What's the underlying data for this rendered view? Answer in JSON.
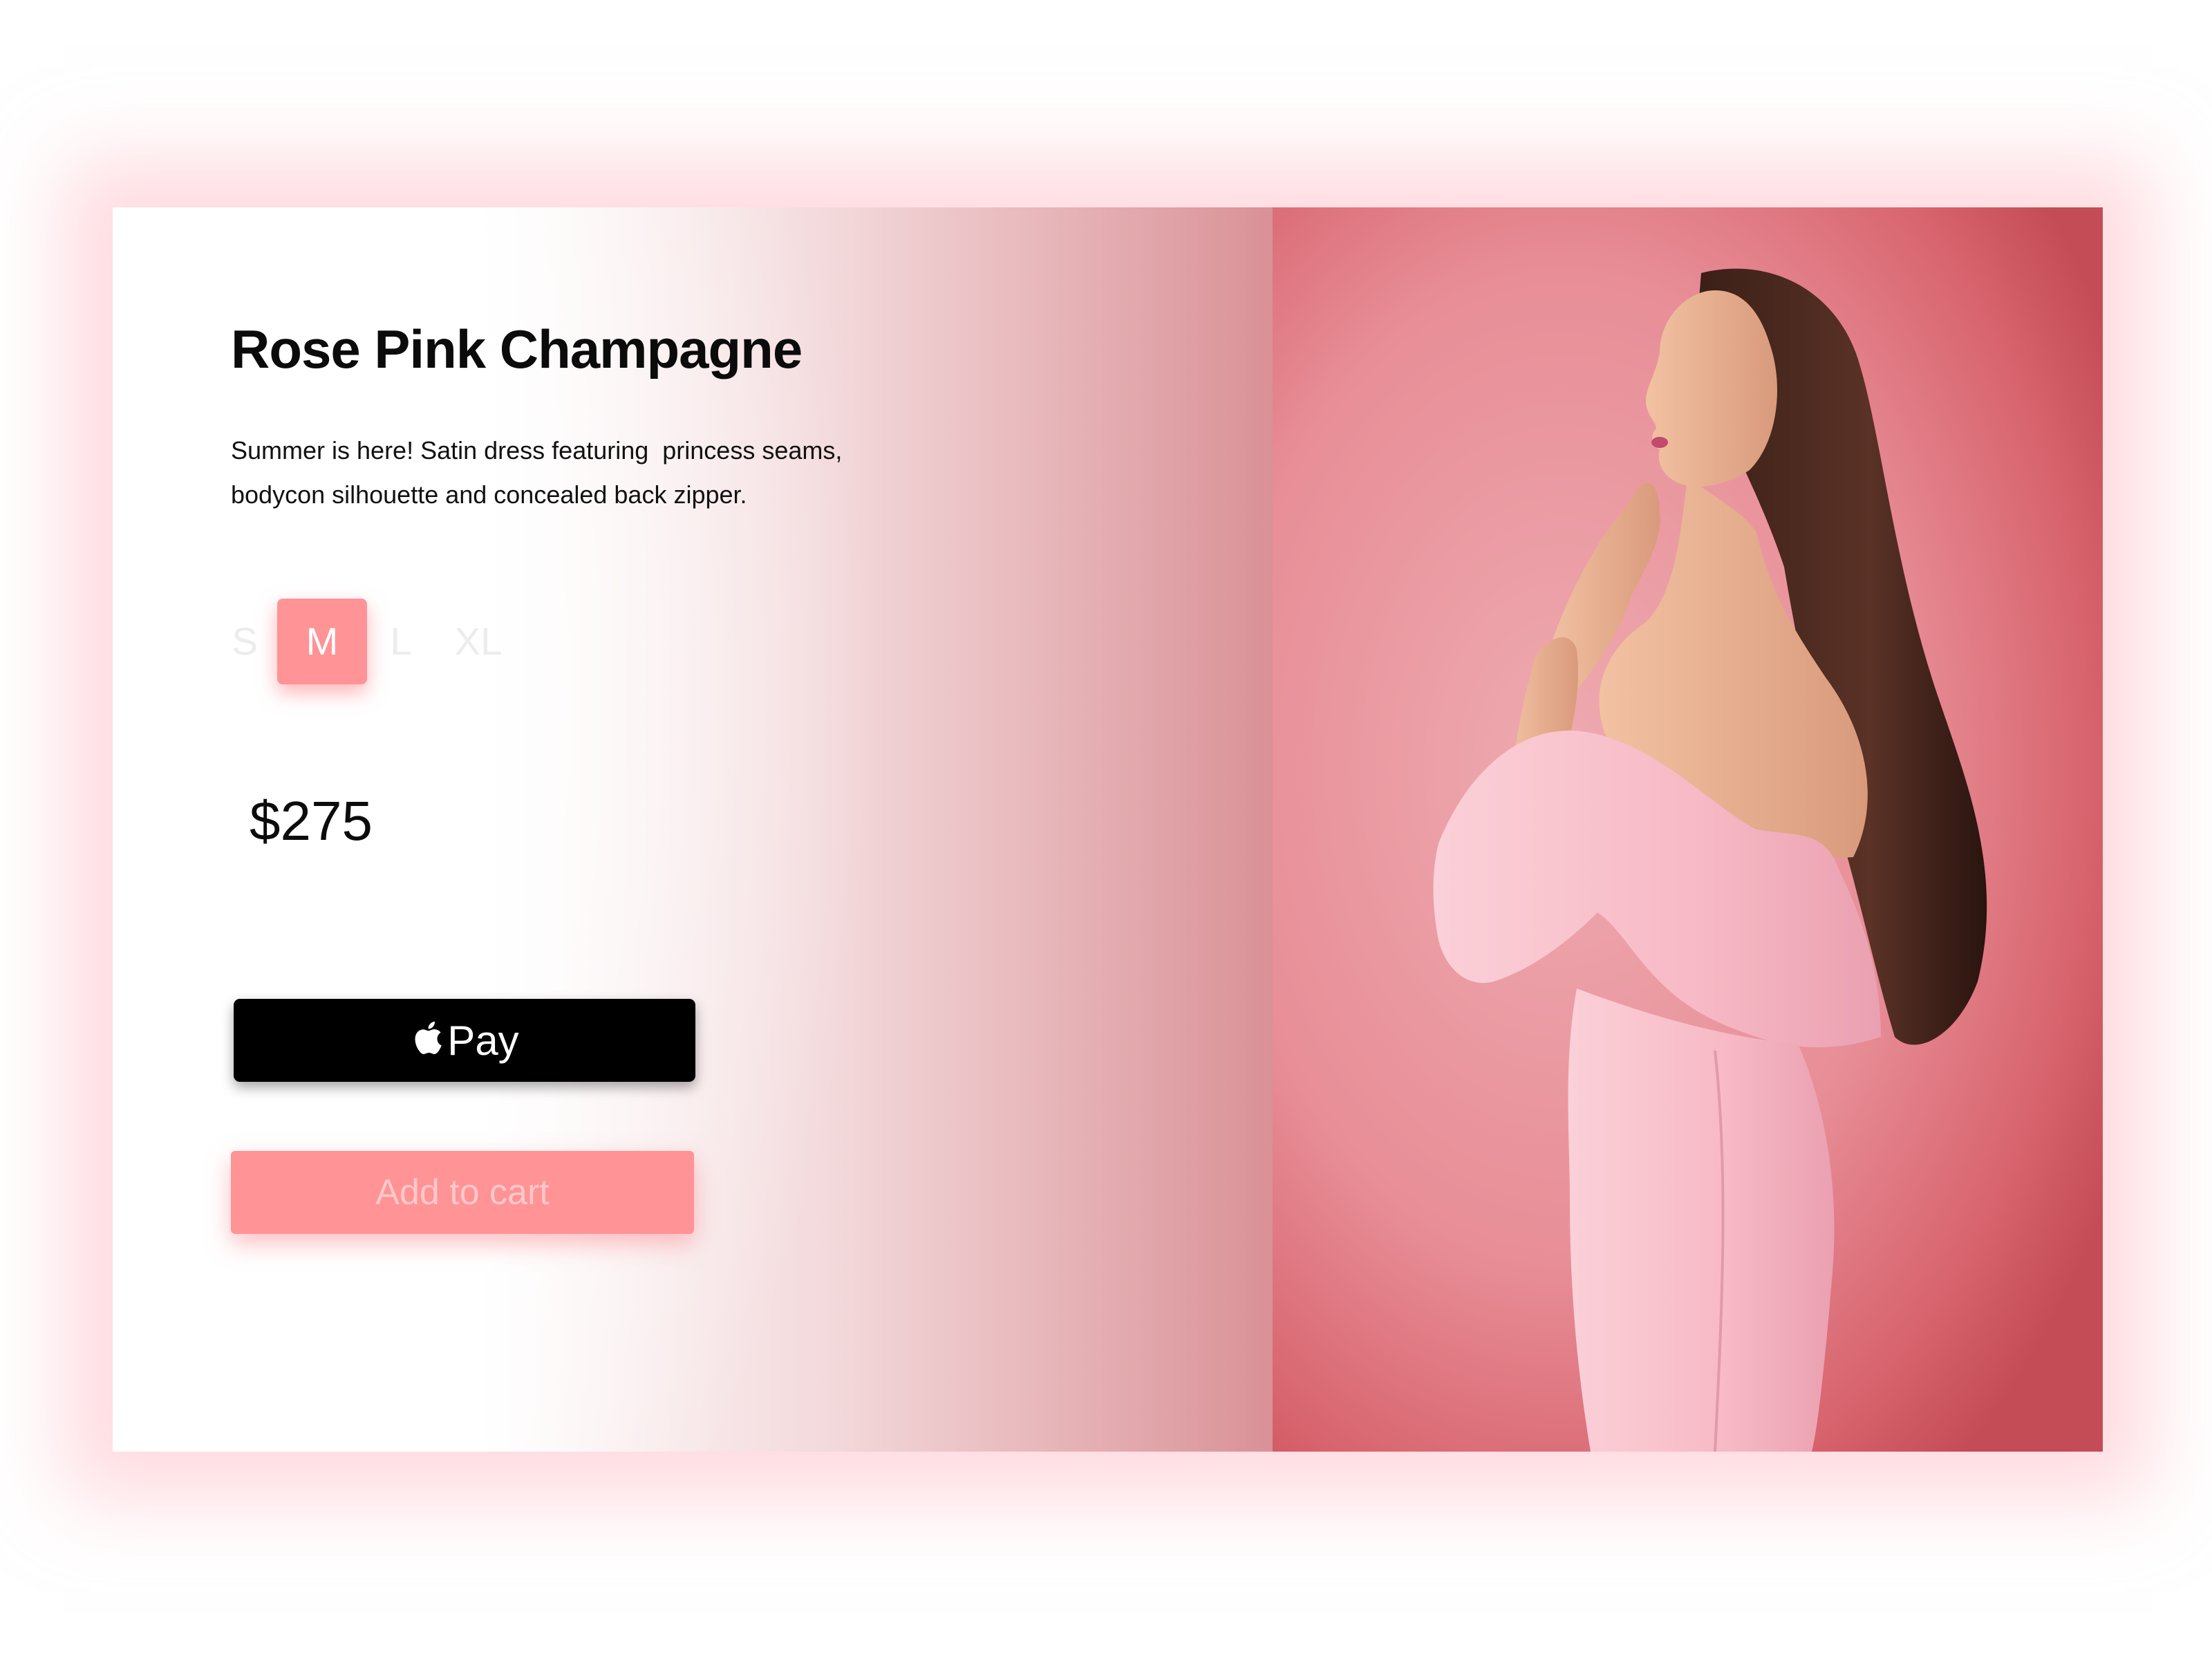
{
  "product": {
    "title": "Rose Pink Champagne",
    "description_lines": [
      "Summer is here! Satin dress featuring  princess seams,",
      "bodycon silhouette and concealed back zipper."
    ],
    "sizes": [
      "S",
      "M",
      "L",
      "XL"
    ],
    "selected_size": "M",
    "price": "$275"
  },
  "actions": {
    "apple_pay_label": "Pay",
    "add_to_cart_label": "Add to cart"
  },
  "colors": {
    "accent": "#ff9396",
    "apple_pay_bg": "#000000",
    "photo_background": "#e88e97",
    "dress": "#f9bcc8"
  },
  "icons": {
    "apple_pay": "apple-icon"
  }
}
